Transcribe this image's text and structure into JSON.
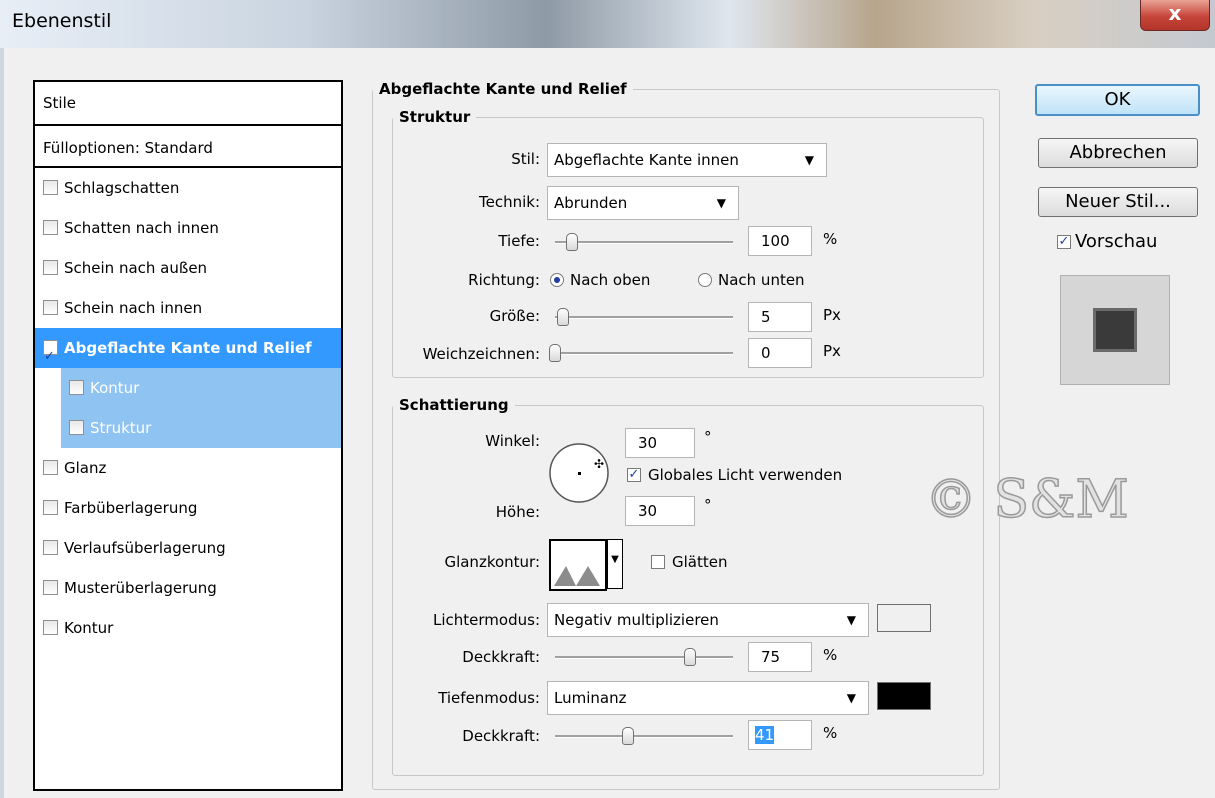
{
  "window": {
    "title": "Ebenenstil",
    "close_glyph": "x"
  },
  "style_list": {
    "header": "Stile",
    "blend_options": "Fülloptionen: Standard",
    "items": [
      {
        "label": "Schlagschatten",
        "checked": false
      },
      {
        "label": "Schatten nach innen",
        "checked": false
      },
      {
        "label": "Schein nach außen",
        "checked": false
      },
      {
        "label": "Schein nach innen",
        "checked": false
      },
      {
        "label": "Abgeflachte Kante und Relief",
        "checked": true,
        "selected": true
      },
      {
        "label": "Kontur",
        "checked": false,
        "sub": true
      },
      {
        "label": "Struktur",
        "checked": false,
        "sub": true
      },
      {
        "label": "Glanz",
        "checked": false
      },
      {
        "label": "Farbüberlagerung",
        "checked": false
      },
      {
        "label": "Verlaufsüberlagerung",
        "checked": false
      },
      {
        "label": "Musterüberlagerung",
        "checked": false
      },
      {
        "label": "Kontur",
        "checked": false
      }
    ]
  },
  "main": {
    "title": "Abgeflachte Kante und Relief",
    "structure": {
      "legend": "Struktur",
      "style_label": "Stil:",
      "style_value": "Abgeflachte Kante innen",
      "technique_label": "Technik:",
      "technique_value": "Abrunden",
      "depth_label": "Tiefe:",
      "depth_value": "100",
      "depth_unit": "%",
      "direction_label": "Richtung:",
      "direction_up": "Nach oben",
      "direction_down": "Nach unten",
      "size_label": "Größe:",
      "size_value": "5",
      "size_unit": "Px",
      "soften_label": "Weichzeichnen:",
      "soften_value": "0",
      "soften_unit": "Px"
    },
    "shading": {
      "legend": "Schattierung",
      "angle_label": "Winkel:",
      "angle_value": "30",
      "angle_unit": "°",
      "global_light": "Globales Licht verwenden",
      "altitude_label": "Höhe:",
      "altitude_value": "30",
      "altitude_unit": "°",
      "gloss_contour_label": "Glanzkontur:",
      "antialias": "Glätten",
      "highlight_mode_label": "Lichtermodus:",
      "highlight_mode_value": "Negativ multiplizieren",
      "highlight_color": "#ffffff",
      "highlight_opacity_label": "Deckkraft:",
      "highlight_opacity_value": "75",
      "highlight_opacity_unit": "%",
      "shadow_mode_label": "Tiefenmodus:",
      "shadow_mode_value": "Luminanz",
      "shadow_color": "#000000",
      "shadow_opacity_label": "Deckkraft:",
      "shadow_opacity_value": "41",
      "shadow_opacity_unit": "%"
    }
  },
  "buttons": {
    "ok": "OK",
    "cancel": "Abbrechen",
    "new_style": "Neuer Stil...",
    "preview": "Vorschau"
  },
  "watermark": "© S&M"
}
